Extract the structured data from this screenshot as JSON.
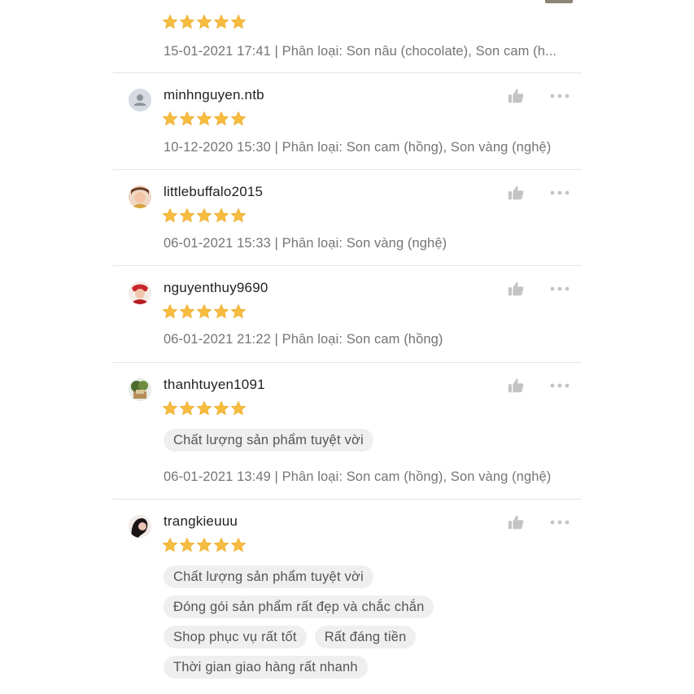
{
  "reviews": [
    {
      "username": "",
      "rating": 5,
      "meta": "15-01-2021 17:41 | Phân loại: Son nâu (chocolate), Son cam (h...",
      "tags": []
    },
    {
      "username": "minhnguyen.ntb",
      "avatar": "default-user-icon",
      "rating": 5,
      "meta": "10-12-2020 15:30 | Phân loại: Son cam (hồng), Son vàng (nghệ)",
      "tags": []
    },
    {
      "username": "littlebuffalo2015",
      "avatar": "user-photo",
      "rating": 5,
      "meta": "06-01-2021 15:33 | Phân loại: Son vàng (nghệ)",
      "tags": []
    },
    {
      "username": "nguyenthuy9690",
      "avatar": "user-photo",
      "rating": 5,
      "meta": "06-01-2021 21:22 | Phân loại: Son cam (hồng)",
      "tags": []
    },
    {
      "username": "thanhtuyen1091",
      "avatar": "user-photo",
      "rating": 5,
      "meta": "06-01-2021 13:49 | Phân loại: Son cam (hồng), Son vàng (nghệ)",
      "tags": [
        "Chất lượng sản phẩm tuyệt vời"
      ]
    },
    {
      "username": "trangkieuuu",
      "avatar": "user-photo",
      "rating": 5,
      "meta": "",
      "tags": [
        "Chất lượng sản phẩm tuyệt vời",
        "Đóng gói sản phẩm rất đẹp và chắc chắn",
        "Shop phục vụ rất tốt",
        "Rất đáng tiền",
        "Thời gian giao hàng rất nhanh"
      ]
    }
  ],
  "colors": {
    "star": "#f6bc3f",
    "icon": "#c4c4c4",
    "divider": "#e5e5e5",
    "meta_text": "#757575"
  },
  "icons": {
    "like": "thumbs-up-icon",
    "more": "more-horizontal-icon",
    "star": "star-icon"
  }
}
